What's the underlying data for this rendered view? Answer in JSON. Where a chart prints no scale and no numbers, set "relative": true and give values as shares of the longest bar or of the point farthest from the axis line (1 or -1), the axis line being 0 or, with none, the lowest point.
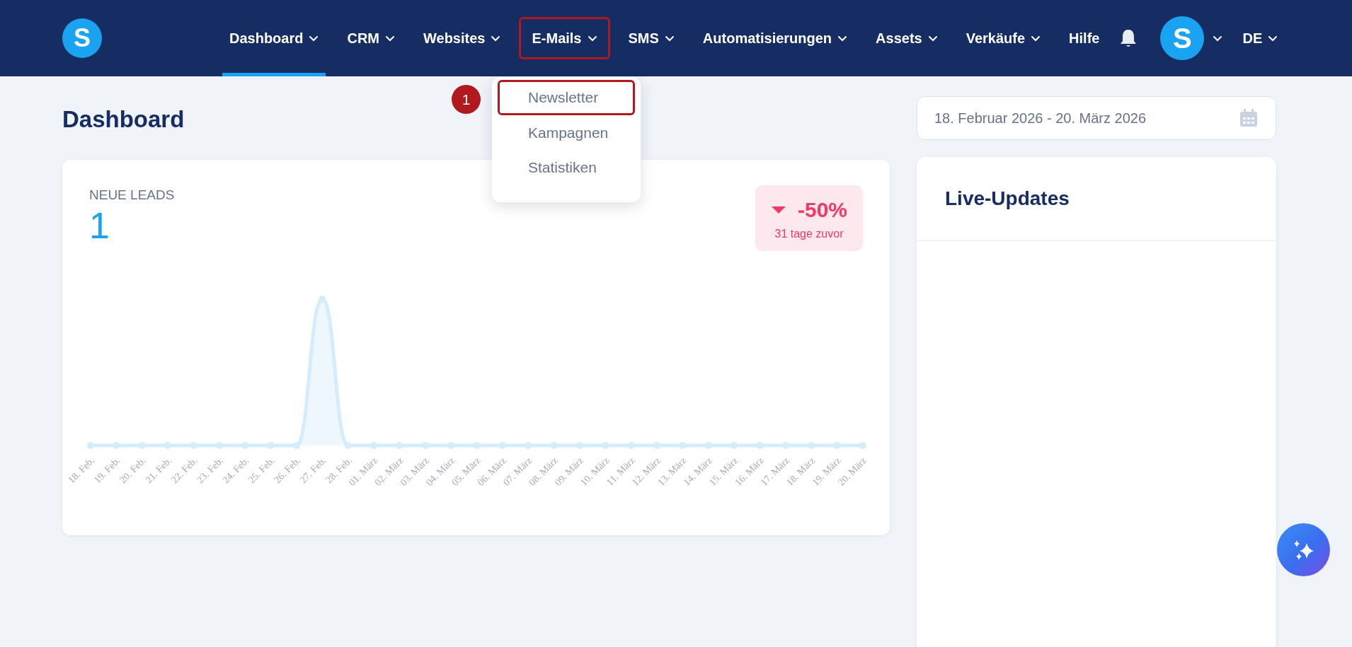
{
  "navbar": {
    "logo": "S",
    "items": [
      {
        "label": "Dashboard",
        "has_dropdown": true,
        "selected": true,
        "highlighted": false
      },
      {
        "label": "CRM",
        "has_dropdown": true,
        "selected": false,
        "highlighted": false
      },
      {
        "label": "Websites",
        "has_dropdown": true,
        "selected": false,
        "highlighted": false
      },
      {
        "label": "E-Mails",
        "has_dropdown": true,
        "selected": false,
        "highlighted": true
      },
      {
        "label": "SMS",
        "has_dropdown": true,
        "selected": false,
        "highlighted": false
      },
      {
        "label": "Automatisierungen",
        "has_dropdown": true,
        "selected": false,
        "highlighted": false
      },
      {
        "label": "Assets",
        "has_dropdown": true,
        "selected": false,
        "highlighted": false
      },
      {
        "label": "Verkäufe",
        "has_dropdown": true,
        "selected": false,
        "highlighted": false
      },
      {
        "label": "Hilfe",
        "has_dropdown": false,
        "selected": false,
        "highlighted": false
      }
    ],
    "avatar": "S",
    "language": "DE"
  },
  "dropdown": {
    "annotation": "1",
    "items": [
      {
        "label": "Newsletter",
        "highlighted": true
      },
      {
        "label": "Kampagnen",
        "highlighted": false
      },
      {
        "label": "Statistiken",
        "highlighted": false
      }
    ]
  },
  "page_title": "Dashboard",
  "date_range": {
    "value": "18. Februar 2026 - 20. März 2026"
  },
  "leads_card": {
    "title": "NEUE LEADS",
    "count": "1",
    "change": "-50%",
    "change_note": "31 tage zuvor",
    "chart_data": {
      "type": "area",
      "relative": true,
      "categories": [
        "18. Feb.",
        "19. Feb.",
        "20. Feb.",
        "21. Feb.",
        "22. Feb.",
        "23. Feb.",
        "24. Feb.",
        "25. Feb.",
        "26. Feb.",
        "27. Feb.",
        "28. Feb.",
        "01. März",
        "02. März",
        "03. März",
        "04. März",
        "05. März",
        "06. März",
        "07. März",
        "08. März",
        "09. März",
        "10. März",
        "11. März",
        "12. März",
        "13. März",
        "14. März",
        "15. März",
        "16. März",
        "17. März",
        "18. März",
        "19. März",
        "20. März"
      ],
      "series": [
        {
          "color": "#d3edfc",
          "values": [
            0,
            0,
            0,
            0,
            0,
            0,
            0,
            0,
            0,
            1,
            0,
            0,
            0,
            0,
            0,
            0,
            0,
            0,
            0,
            0,
            0,
            0,
            0,
            0,
            0,
            0,
            0,
            0,
            0,
            0,
            0
          ]
        }
      ]
    }
  },
  "live_card": {
    "title": "Live-Updates"
  }
}
